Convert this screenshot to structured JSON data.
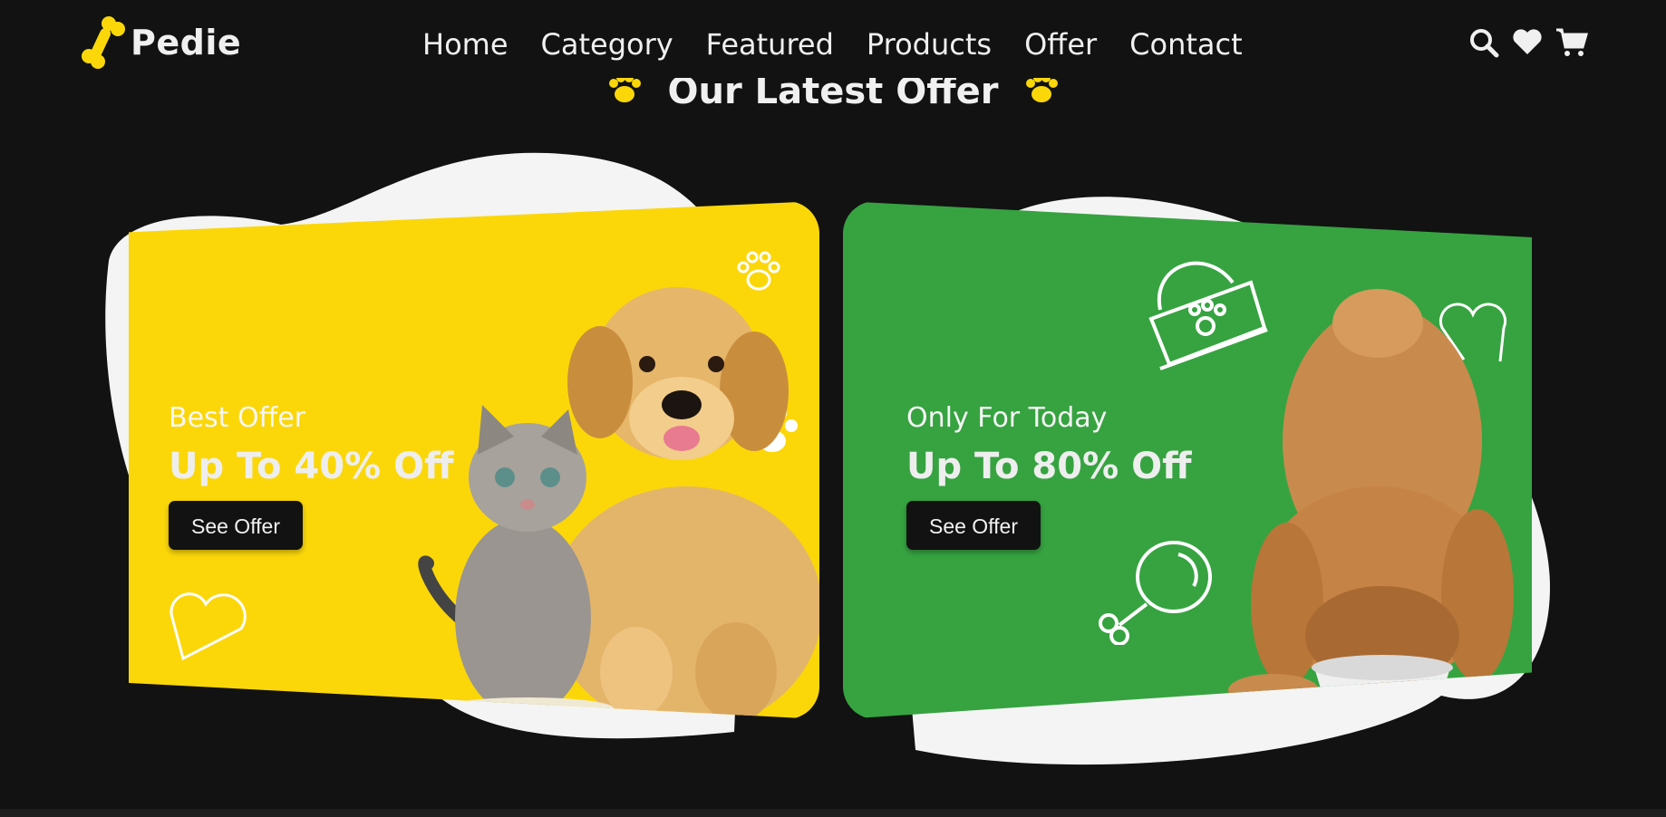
{
  "brand": {
    "name": "Pedie"
  },
  "nav": {
    "items": [
      {
        "label": "Home"
      },
      {
        "label": "Category"
      },
      {
        "label": "Featured"
      },
      {
        "label": "Products"
      },
      {
        "label": "Offer"
      },
      {
        "label": "Contact"
      }
    ],
    "icons": [
      "search-icon",
      "heart-icon",
      "cart-icon"
    ]
  },
  "section": {
    "title": "Our Latest Offer"
  },
  "offers": [
    {
      "subtitle": "Best Offer",
      "headline": "Up To 40% Off",
      "button": "See Offer",
      "color": "#fbd70a"
    },
    {
      "subtitle": "Only For Today",
      "headline": "Up To 80% Off",
      "button": "See Offer",
      "color": "#36a340"
    }
  ],
  "colors": {
    "background": "#121212",
    "accent": "#fbd70a",
    "green": "#36a340",
    "text": "#f0f0f0"
  }
}
